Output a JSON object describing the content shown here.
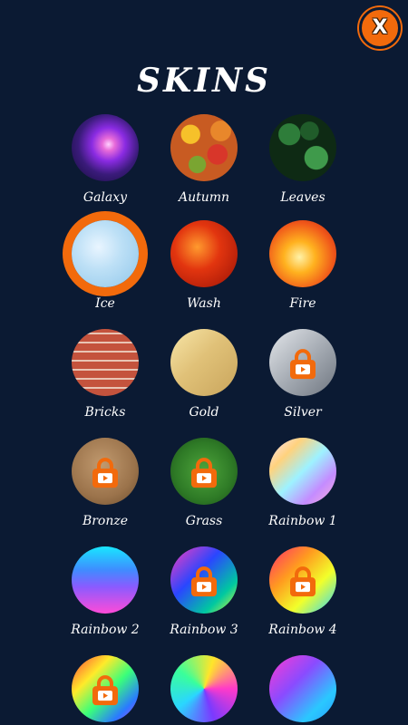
{
  "header": {
    "title": "SKINS",
    "close_label": "X"
  },
  "skins": [
    {
      "label": "Galaxy",
      "locked": false,
      "selected": false
    },
    {
      "label": "Autumn",
      "locked": false,
      "selected": false
    },
    {
      "label": "Leaves",
      "locked": false,
      "selected": false
    },
    {
      "label": "Ice",
      "locked": false,
      "selected": true
    },
    {
      "label": "Wash",
      "locked": false,
      "selected": false
    },
    {
      "label": "Fire",
      "locked": false,
      "selected": false
    },
    {
      "label": "Bricks",
      "locked": false,
      "selected": false
    },
    {
      "label": "Gold",
      "locked": false,
      "selected": false
    },
    {
      "label": "Silver",
      "locked": true,
      "selected": false
    },
    {
      "label": "Bronze",
      "locked": true,
      "selected": false
    },
    {
      "label": "Grass",
      "locked": true,
      "selected": false
    },
    {
      "label": "Rainbow 1",
      "locked": false,
      "selected": false
    },
    {
      "label": "Rainbow 2",
      "locked": false,
      "selected": false
    },
    {
      "label": "Rainbow 3",
      "locked": true,
      "selected": false
    },
    {
      "label": "Rainbow 4",
      "locked": true,
      "selected": false
    },
    {
      "label": "",
      "locked": true,
      "selected": false
    },
    {
      "label": "",
      "locked": false,
      "selected": false
    },
    {
      "label": "",
      "locked": false,
      "selected": false
    }
  ],
  "colors": {
    "background": "#0b1a33",
    "accent": "#f26a0c",
    "text": "#ffffff"
  },
  "icons": {
    "close": "close-icon",
    "lock": "lock-video-icon"
  }
}
